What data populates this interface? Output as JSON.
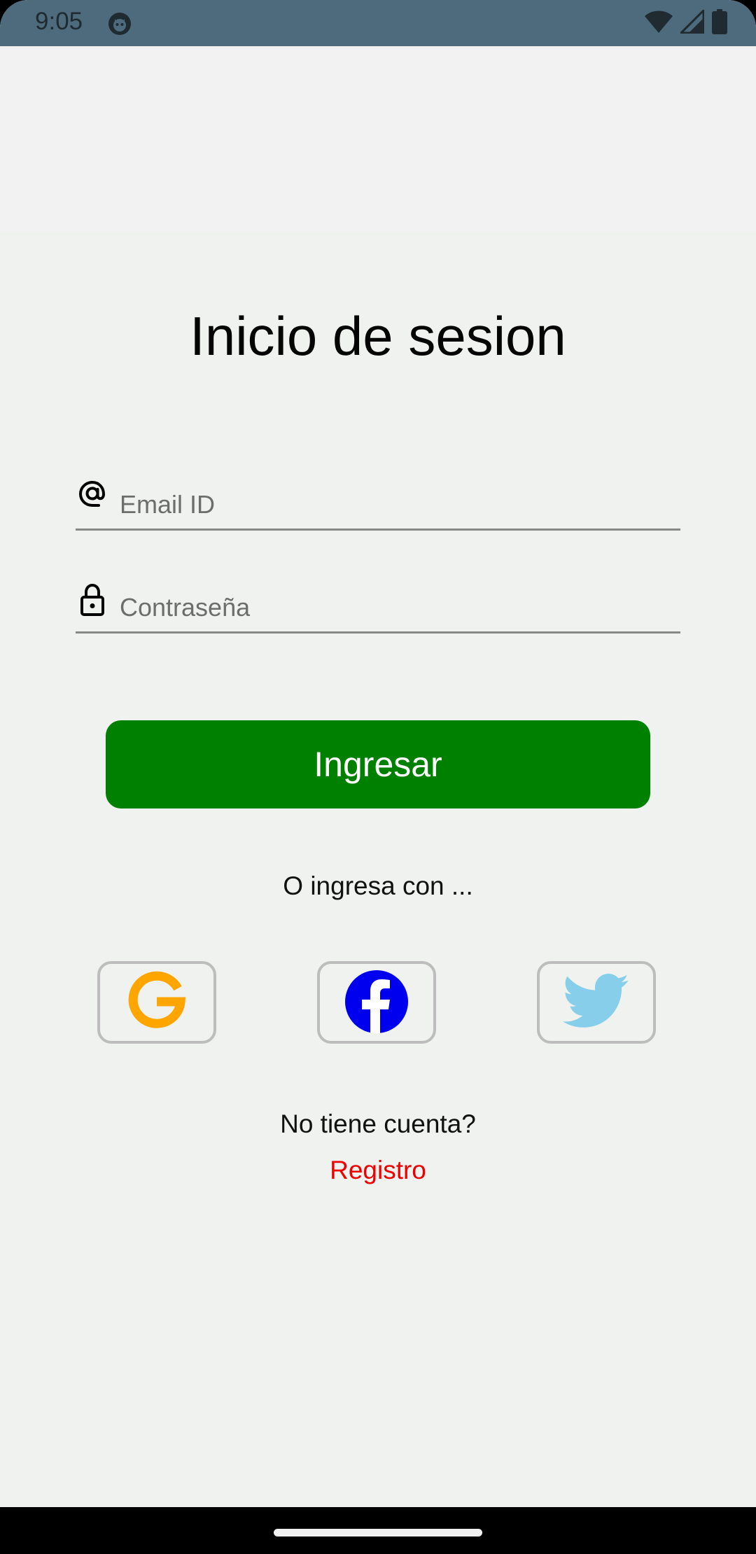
{
  "status_bar": {
    "time": "9:05",
    "icons": [
      "app-notification-icon",
      "wifi-icon",
      "cell-signal-icon",
      "battery-icon"
    ]
  },
  "login": {
    "title": "Inicio de sesion",
    "email": {
      "icon": "at-sign-icon",
      "placeholder": "Email ID",
      "value": ""
    },
    "password": {
      "icon": "lock-icon",
      "placeholder": "Contraseña",
      "value": ""
    },
    "submit_label": "Ingresar",
    "or_text": "O ingresa con ...",
    "social": [
      {
        "name": "google",
        "icon": "google-icon"
      },
      {
        "name": "facebook",
        "icon": "facebook-icon"
      },
      {
        "name": "twitter",
        "icon": "twitter-icon"
      }
    ],
    "no_account_text": "No tiene cuenta?",
    "register_label": "Registro"
  },
  "colors": {
    "status_bar": "#4d6b7d",
    "background": "#eff2ee",
    "primary_button": "#008000",
    "register_link": "#ee0000",
    "google": "#ffa500",
    "facebook": "#0000ee",
    "twitter": "#87ceeb"
  }
}
